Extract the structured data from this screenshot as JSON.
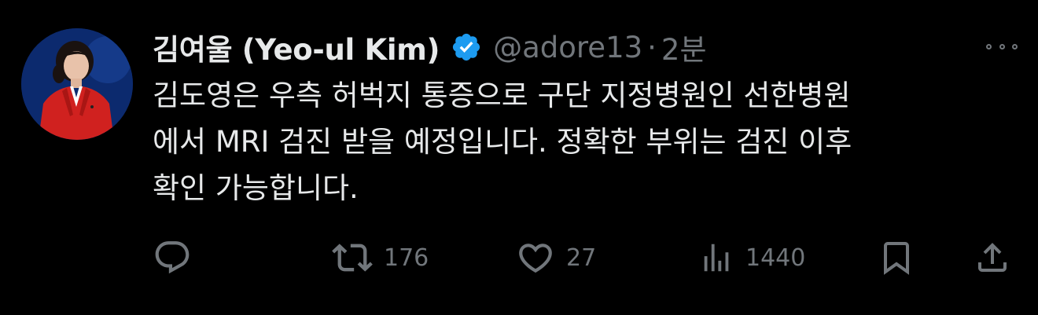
{
  "author": {
    "display_name": "김여울 (Yeo-ul Kim)",
    "handle": "@adore13",
    "separator": "·",
    "time": "2분",
    "verified_color": "#1d9bf0"
  },
  "tweet": {
    "lines": [
      "김도영은 우측 허벅지 통증으로 구단 지정병원인 선한병원",
      "에서 MRI 검진 받을 예정입니다. 정확한 부위는 검진 이후",
      "확인 가능합니다."
    ]
  },
  "actions": {
    "reply": {
      "icon": "reply-icon",
      "count": ""
    },
    "retweet": {
      "icon": "retweet-icon",
      "count": "176"
    },
    "like": {
      "icon": "heart-icon",
      "count": "27"
    },
    "views": {
      "icon": "views-icon",
      "count": "1440"
    },
    "bookmark": {
      "icon": "bookmark-icon"
    },
    "share": {
      "icon": "share-icon"
    }
  },
  "colors": {
    "background": "#000000",
    "text": "#e7e9ea",
    "muted": "#71767b",
    "accent": "#1d9bf0"
  }
}
